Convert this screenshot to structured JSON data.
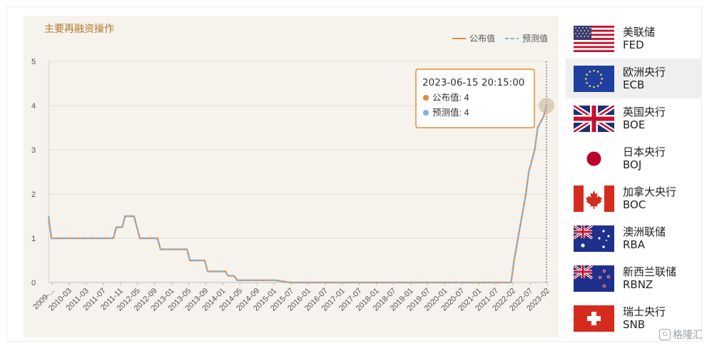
{
  "chart_data": {
    "type": "line",
    "title": "主要再融资操作",
    "ylim": [
      0,
      5
    ],
    "yticks": [
      "0",
      "1",
      "2",
      "3",
      "4",
      "5"
    ],
    "x_tick_labels": [
      "2009-...",
      "2010-03",
      "2011-03",
      "2011-07",
      "2011-11",
      "2012-05",
      "2012-09",
      "2013-01",
      "2013-05",
      "2013-09",
      "2014-01",
      "2014-05",
      "2014-09",
      "2015-01",
      "2015-07",
      "2016-01",
      "2016-07",
      "2017-01",
      "2017-07",
      "2018-01",
      "2018-07",
      "2019-01",
      "2019-07",
      "2020-01",
      "2020-07",
      "2021-01",
      "2021-07",
      "2022-02",
      "2022-07",
      "2023-02"
    ],
    "legend": {
      "position": "top-right",
      "items": [
        "公布值",
        "预测值"
      ]
    },
    "colors": {
      "published": "#e8893a",
      "forecast": "#7cb3e6",
      "tooltip_border": "#e8893a"
    },
    "series": [
      {
        "name": "公布值",
        "x": [
          "2009-05",
          "2009-06",
          "2011-03",
          "2011-04",
          "2011-06",
          "2011-07",
          "2011-10",
          "2011-12",
          "2012-06",
          "2012-07",
          "2013-04",
          "2013-05",
          "2013-10",
          "2013-11",
          "2014-05",
          "2014-06",
          "2014-08",
          "2014-09",
          "2015-10",
          "2016-03",
          "2022-06",
          "2022-07",
          "2022-09",
          "2022-11",
          "2022-12",
          "2023-02",
          "2023-03",
          "2023-05",
          "2023-06"
        ],
        "values": [
          1.5,
          1.0,
          1.0,
          1.25,
          1.25,
          1.5,
          1.5,
          1.0,
          1.0,
          0.75,
          0.75,
          0.5,
          0.5,
          0.25,
          0.25,
          0.15,
          0.15,
          0.05,
          0.05,
          0.0,
          0.0,
          0.5,
          1.25,
          2.0,
          2.5,
          3.0,
          3.5,
          3.75,
          4.0
        ]
      },
      {
        "name": "预测值",
        "x": [
          "2009-05",
          "2009-06",
          "2011-03",
          "2011-04",
          "2011-06",
          "2011-07",
          "2011-10",
          "2011-12",
          "2012-06",
          "2012-07",
          "2013-04",
          "2013-05",
          "2013-10",
          "2013-11",
          "2014-05",
          "2014-06",
          "2014-08",
          "2014-09",
          "2015-10",
          "2016-03",
          "2022-06",
          "2022-07",
          "2022-09",
          "2022-11",
          "2022-12",
          "2023-02",
          "2023-03",
          "2023-05",
          "2023-06"
        ],
        "values": [
          1.5,
          1.0,
          1.0,
          1.25,
          1.25,
          1.5,
          1.5,
          1.0,
          1.0,
          0.75,
          0.75,
          0.5,
          0.5,
          0.25,
          0.25,
          0.15,
          0.15,
          0.05,
          0.05,
          0.0,
          0.0,
          0.5,
          1.25,
          2.0,
          2.5,
          3.0,
          3.5,
          3.75,
          4.0
        ]
      }
    ],
    "tooltip": {
      "date": "2023-06-15 20:15:00",
      "rows": [
        {
          "label": "公布值",
          "value": "4"
        },
        {
          "label": "预测值",
          "value": "4"
        }
      ]
    }
  },
  "banks": [
    {
      "name": "美联储",
      "code": "FED",
      "flag": "us-flag"
    },
    {
      "name": "欧洲央行",
      "code": "ECB",
      "flag": "eu-flag",
      "active": true
    },
    {
      "name": "英国央行",
      "code": "BOE",
      "flag": "uk-flag"
    },
    {
      "name": "日本央行",
      "code": "BOJ",
      "flag": "jp-flag"
    },
    {
      "name": "加拿大央行",
      "code": "BOC",
      "flag": "ca-flag"
    },
    {
      "name": "澳洲联储",
      "code": "RBA",
      "flag": "au-flag"
    },
    {
      "name": "新西兰联储",
      "code": "RBNZ",
      "flag": "nz-flag"
    },
    {
      "name": "瑞士央行",
      "code": "SNB",
      "flag": "ch-flag"
    }
  ],
  "watermark": "格隆汇"
}
